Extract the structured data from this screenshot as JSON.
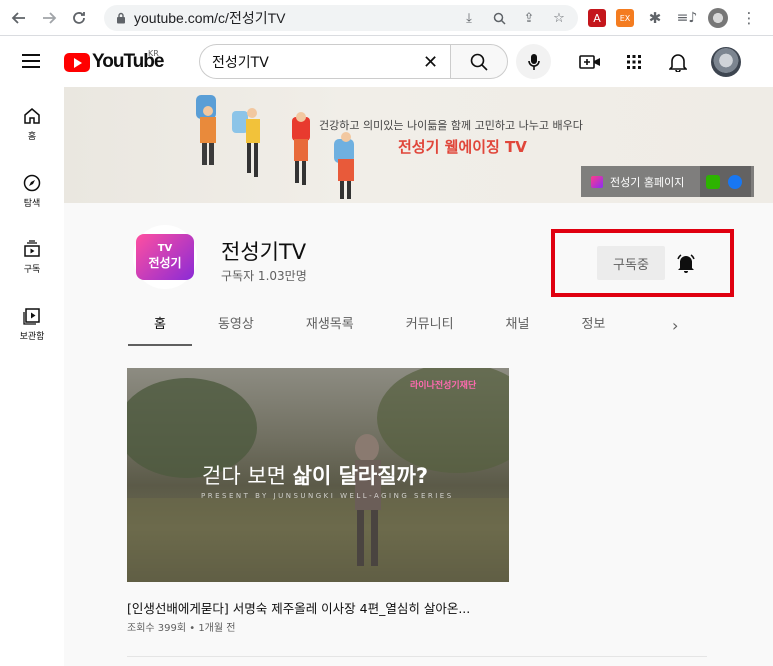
{
  "browser": {
    "url": "youtube.com/c/전성기TV"
  },
  "masthead": {
    "logo_text": "YouTube",
    "region": "KR",
    "search_value": "전성기TV"
  },
  "sidebar": {
    "items": [
      {
        "label": "홈",
        "icon": "home-icon"
      },
      {
        "label": "탐색",
        "icon": "compass-icon"
      },
      {
        "label": "구독",
        "icon": "subscriptions-icon"
      },
      {
        "label": "보관함",
        "icon": "library-icon"
      }
    ]
  },
  "banner": {
    "tagline": "건강하고 의미있는 나이듦을 함께 고민하고 나누고 배우다",
    "title": "전성기 웰에이징 TV",
    "homepage_label": "전성기 홈페이지"
  },
  "channel": {
    "avatar_top": "TV",
    "avatar_bottom": "전성기",
    "name": "전성기TV",
    "subscribers": "구독자 1.03만명",
    "subscribed_label": "구독중"
  },
  "tabs": [
    {
      "label": "홈",
      "active": true
    },
    {
      "label": "동영상",
      "active": false
    },
    {
      "label": "재생목록",
      "active": false
    },
    {
      "label": "커뮤니티",
      "active": false
    },
    {
      "label": "채널",
      "active": false
    },
    {
      "label": "정보",
      "active": false
    }
  ],
  "video": {
    "thumb_logo": "라이나전성기재단",
    "thumb_title_a": "걷다 보면 ",
    "thumb_title_b": "삶이 달라질까?",
    "thumb_sub": "PRESENT BY JUNSUNGKI WELL-AGING SERIES",
    "title": "[인생선배에게묻다] 서명숙 제주올레 이사장 4편_열심히 살아온...",
    "meta": "조회수 399회 • 1개월 전"
  },
  "colors": {
    "youtube_red": "#ff0000",
    "highlight": "#e00010",
    "banner_accent": "#e0463a"
  }
}
